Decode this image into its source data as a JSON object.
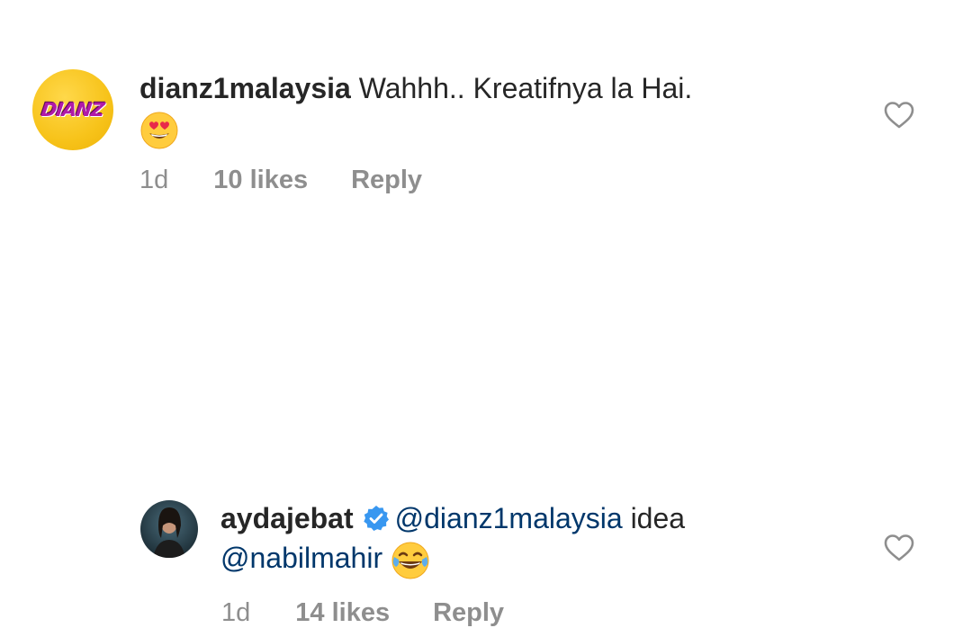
{
  "comments": [
    {
      "avatar_text": "DIANZ",
      "username": "dianz1malaysia",
      "text": "Wahhh.. Kreatifnya la Hai.",
      "emoji": "heart-eyes-emoji",
      "time": "1d",
      "likes": "10 likes",
      "reply_label": "Reply"
    },
    {
      "username": "aydajebat",
      "verified": true,
      "mention1": "@dianz1malaysia",
      "text": "idea",
      "mention2": "@nabilmahir",
      "emoji": "tears-of-joy-emoji",
      "time": "1d",
      "likes": "14 likes",
      "reply_label": "Reply"
    }
  ],
  "colors": {
    "username": "#262626",
    "mention": "#00376b",
    "meta": "#8e8e8e",
    "verified": "#3897f0",
    "dianz_avatar": "#f7c31a",
    "dianz_logo": "#b01aa8"
  }
}
